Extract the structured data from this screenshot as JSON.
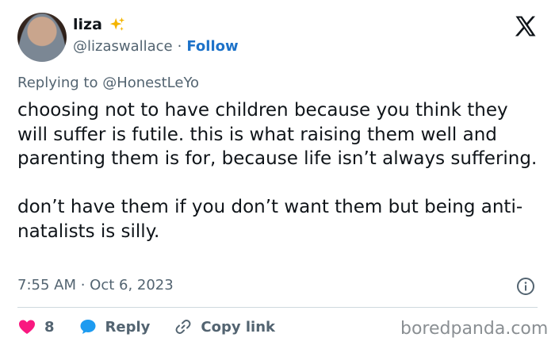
{
  "author": {
    "display_name": "liza",
    "handle": "@lizaswallace",
    "separator": "·",
    "follow_label": "Follow"
  },
  "reply_context": "Replying to @HonestLeYo",
  "tweet": {
    "text": "choosing not to have children because you think they will suffer is futile. this is what raising them well and parenting them is for, because life isn’t always suffering.\n\ndon’t have them if you don’t want them but being anti-natalists is silly.",
    "timestamp": "7:55 AM · Oct 6, 2023"
  },
  "actions": {
    "like_count": "8",
    "reply_label": "Reply",
    "copy_link_label": "Copy link"
  },
  "watermark": "boredpanda.com",
  "icons": {
    "verified_emoji": "sparkles-icon",
    "brand": "x-logo-icon",
    "info": "info-icon",
    "like": "heart-icon",
    "reply": "speech-bubble-icon",
    "copy": "link-icon"
  },
  "colors": {
    "follow": "#1d72c9",
    "heart": "#f91880",
    "reply_bubble": "#1d9bf0",
    "muted": "#536471"
  }
}
